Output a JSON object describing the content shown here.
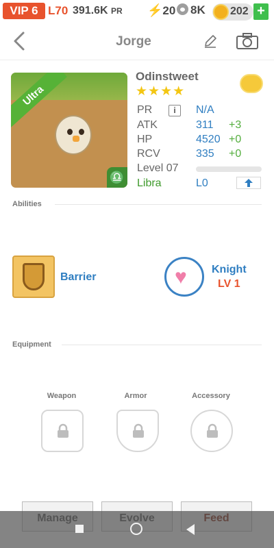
{
  "topbar": {
    "vip": "VIP 6",
    "level": "L70",
    "pr_value": "391.6K",
    "pr_unit": "PR",
    "energy": "20",
    "paws": "8K",
    "coins": "202",
    "add": "+"
  },
  "header": {
    "title": "Jorge",
    "icons": [
      "back-icon",
      "pencil-icon",
      "camera-icon"
    ]
  },
  "pet": {
    "badge": "Ultra",
    "zodiac_symbol": "♎",
    "name": "Odinstweet",
    "stars": "★★★★",
    "stats": {
      "pr_label": "PR",
      "pr_info": "i",
      "pr_value": "N/A",
      "atk_label": "ATK",
      "atk_value": "311",
      "atk_bonus": "+3",
      "hp_label": "HP",
      "hp_value": "4520",
      "hp_bonus": "+0",
      "rcv_label": "RCV",
      "rcv_value": "335",
      "rcv_bonus": "+0",
      "level_label": "Level 07",
      "level_progress": 0,
      "sign_label": "Libra",
      "sign_level": "L0"
    }
  },
  "abilities": {
    "section_label": "Abilities",
    "barrier": "Barrier",
    "knight": "Knight",
    "knight_level": "LV 1"
  },
  "equipment": {
    "section_label": "Equipment",
    "weapon": "Weapon",
    "armor": "Armor",
    "accessory": "Accessory"
  },
  "actions": {
    "manage": "Manage",
    "evolve": "Evolve",
    "feed": "Feed"
  },
  "colors": {
    "accent_orange": "#e8532d",
    "stat_blue": "#2f7ec1",
    "bonus_green": "#54ae3e",
    "ultra_green": "#56b237"
  }
}
